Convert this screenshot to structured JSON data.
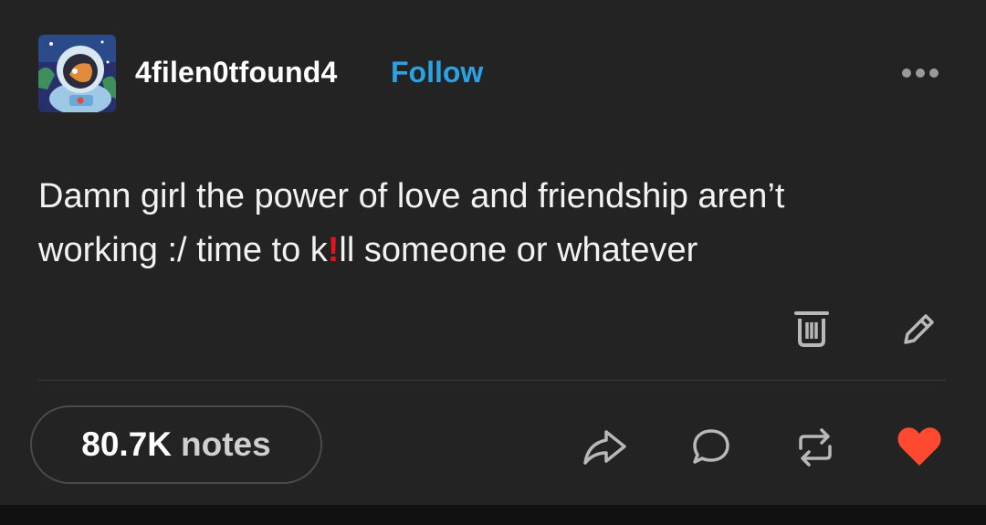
{
  "header": {
    "username": "4filen0tfound4",
    "follow_label": "Follow"
  },
  "post": {
    "line1": "Damn girl the power of love and friendship aren’t",
    "line2_before": "working :/ time to k",
    "line2_mark": "!",
    "line2_after": "ll someone or whatever"
  },
  "footer": {
    "notes_count": "80.7K",
    "notes_label": "notes"
  },
  "icons": {
    "more": "more-options-icon",
    "delete": "trash-icon",
    "edit": "pencil-icon",
    "share": "share-icon",
    "reply": "reply-icon",
    "reblog": "reblog-icon",
    "like": "heart-icon"
  },
  "colors": {
    "background": "#232323",
    "accent": "#2aa3e5",
    "like": "#ff4930",
    "mark": "#e2141b"
  }
}
